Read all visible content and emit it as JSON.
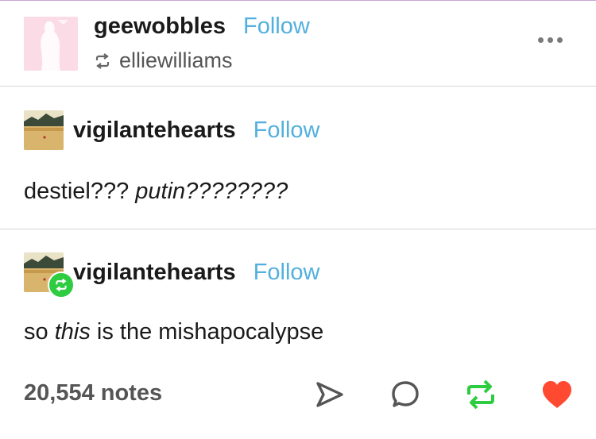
{
  "header": {
    "blog_name": "geewobbles",
    "follow_label": "Follow",
    "reblogged_from": "elliewilliams"
  },
  "trail": [
    {
      "blog_name": "vigilantehearts",
      "follow_label": "Follow",
      "text_before": "destiel??? ",
      "text_italic": "putin????????",
      "text_after": ""
    },
    {
      "blog_name": "vigilantehearts",
      "follow_label": "Follow",
      "text_before": "so ",
      "text_italic": "this",
      "text_after": " is the mishapocalypse"
    }
  ],
  "footer": {
    "notes": "20,554 notes",
    "icons": [
      "share-icon",
      "reply-icon",
      "reblog-icon",
      "like-icon"
    ]
  },
  "colors": {
    "follow": "#52b0de",
    "reblog": "#2ecc40",
    "like": "#ff4930",
    "header_avatar": "#fbdbe6"
  }
}
